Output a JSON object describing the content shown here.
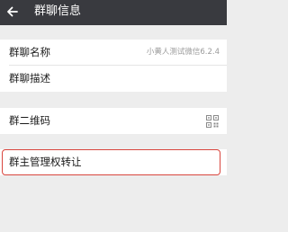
{
  "header": {
    "back_icon": "arrow-left-icon",
    "title": "群聊信息"
  },
  "settings": {
    "group_name_label": "群聊名称",
    "group_name_value": "小黄人测试微信6.2.4",
    "group_description_label": "群聊描述",
    "qr_code_label": "群二维码",
    "qr_icon": "qr-code-icon",
    "transfer_owner_label": "群主管理权转让"
  },
  "colors": {
    "titlebar_bg": "#393a3f",
    "page_bg": "#ededed",
    "highlight_border": "#d9463e"
  }
}
